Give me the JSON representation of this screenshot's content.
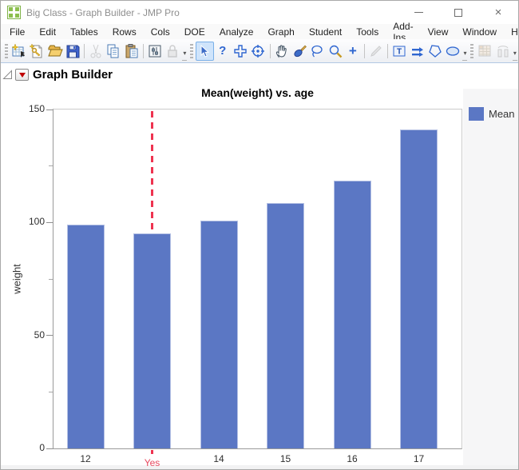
{
  "window": {
    "title": "Big Class - Graph Builder - JMP Pro",
    "controls": [
      "minimize-icon",
      "maximize-icon",
      "close-icon"
    ]
  },
  "menu": {
    "items": [
      "File",
      "Edit",
      "Tables",
      "Rows",
      "Cols",
      "DOE",
      "Analyze",
      "Graph",
      "Student",
      "Tools",
      "Add-Ins",
      "View",
      "Window",
      "Help"
    ]
  },
  "toolbar": {
    "icons": [
      "new-data-table-icon",
      "new-script-icon",
      "open-folder-icon",
      "save-icon",
      "cut-icon",
      "copy-icon",
      "paste-icon",
      "preferences-icon",
      "lock-icon",
      "arrow-tool-icon",
      "help-icon",
      "cross-tool-icon",
      "target-tool-icon",
      "hand-tool-icon",
      "brush-tool-icon",
      "lasso-tool-icon",
      "magnifier-tool-icon",
      "plus-tool-icon",
      "pencil-tool-icon",
      "text-annotation-icon",
      "arrows-annotation-icon",
      "polygon-annotation-icon",
      "oval-annotation-icon",
      "data-table-window-icon",
      "columns-window-icon"
    ],
    "disabled": [
      "cut-icon",
      "lock-icon",
      "pencil-icon",
      "data-table-window-icon",
      "columns-window-icon"
    ],
    "selected_tool": "arrow-tool-icon",
    "help_glyph": "?",
    "plus_glyph": "+",
    "overflow_glyph": "▾"
  },
  "report": {
    "outline_title": "Graph Builder"
  },
  "legend": {
    "label": "Mean",
    "swatch_color": "#5b77c4"
  },
  "chart_data": {
    "type": "bar",
    "title": "Mean(weight) vs. age",
    "xlabel": "",
    "ylabel": "weight",
    "categories": [
      "12",
      "Yes",
      "14",
      "15",
      "16",
      "17"
    ],
    "values": [
      99,
      95,
      101,
      108.5,
      118.5,
      141
    ],
    "series_name": "Mean",
    "ylim": [
      0,
      150
    ],
    "yticks_major": [
      0,
      50,
      100,
      150
    ],
    "yticks_minor": [
      25,
      75,
      125
    ],
    "bar_color": "#5b77c4",
    "grid": false,
    "legend_position": "right",
    "reference_line": {
      "category_index": 1,
      "label": "Yes",
      "style": "dashed",
      "color": "#ee3350",
      "label_color": "#e8495f"
    }
  }
}
